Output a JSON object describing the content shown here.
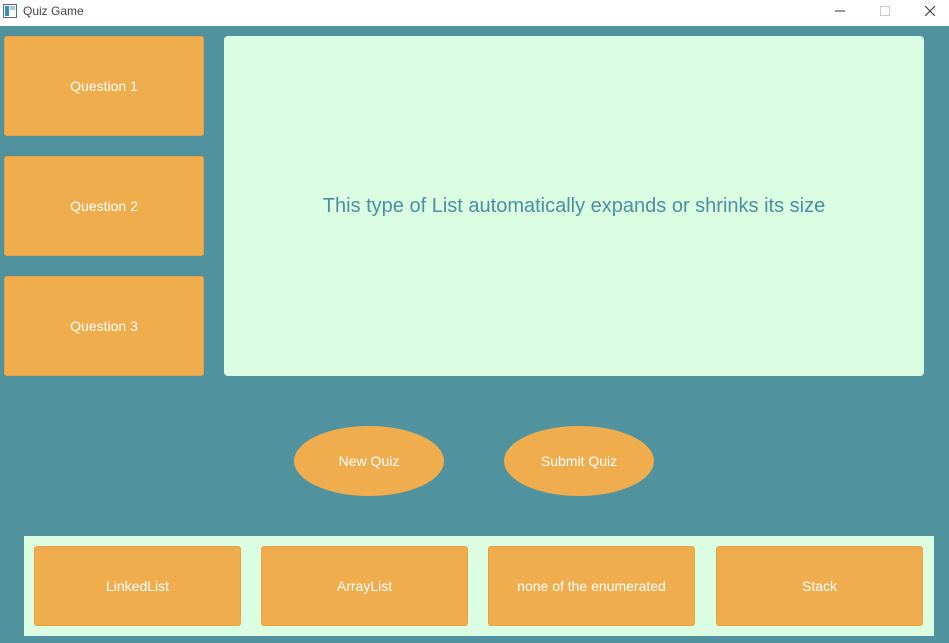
{
  "window": {
    "title": "Quiz Game"
  },
  "questions": [
    {
      "label": "Question 1"
    },
    {
      "label": "Question 2"
    },
    {
      "label": "Question 3"
    }
  ],
  "current_question": {
    "text": "This type of List automatically expands or shrinks its size"
  },
  "actions": {
    "new_quiz_label": "New Quiz",
    "submit_quiz_label": "Submit Quiz"
  },
  "answers": [
    {
      "label": "LinkedList"
    },
    {
      "label": "ArrayList"
    },
    {
      "label": "none of the enumerated"
    },
    {
      "label": "Stack"
    }
  ],
  "colors": {
    "background": "#50939f",
    "button": "#f0ad4e",
    "panel": "#dbfee3",
    "question_text": "#4a90a0"
  },
  "icons": {
    "app": "window-app-icon",
    "minimize": "minimize-icon",
    "maximize": "maximize-icon",
    "close": "close-icon"
  }
}
